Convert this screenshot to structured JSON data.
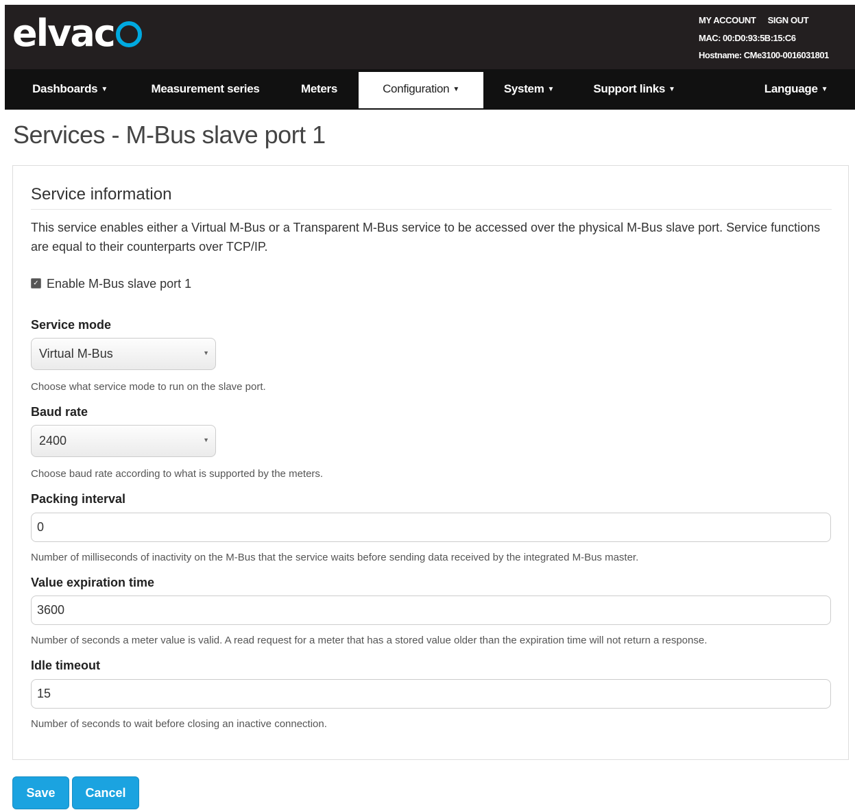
{
  "header": {
    "logo_text": "elvac",
    "account_links": [
      "MY ACCOUNT",
      "SIGN OUT"
    ],
    "mac": "MAC: 00:D0:93:5B:15:C6",
    "hostname": "Hostname: CMe3100-0016031801"
  },
  "nav": {
    "items": [
      {
        "label": "Dashboards",
        "dropdown": true
      },
      {
        "label": "Measurement series",
        "dropdown": false
      },
      {
        "label": "Meters",
        "dropdown": false
      },
      {
        "label": "Configuration",
        "dropdown": true,
        "active": true
      },
      {
        "label": "System",
        "dropdown": true
      },
      {
        "label": "Support links",
        "dropdown": true
      },
      {
        "label": "Language",
        "dropdown": true
      }
    ]
  },
  "page_title": "Services - M-Bus slave port 1",
  "section": {
    "title": "Service information",
    "description": "This service enables either a Virtual M-Bus or a Transparent M-Bus service to be accessed over the physical M-Bus slave port. Service functions are equal to their counterparts over TCP/IP.",
    "enable_label": "Enable M-Bus slave port 1",
    "enable_checked": true
  },
  "form": {
    "service_mode": {
      "label": "Service mode",
      "value": "Virtual M-Bus",
      "help": "Choose what service mode to run on the slave port."
    },
    "baud_rate": {
      "label": "Baud rate",
      "value": "2400",
      "help": "Choose baud rate according to what is supported by the meters."
    },
    "packing_interval": {
      "label": "Packing interval",
      "value": "0",
      "help": "Number of milliseconds of inactivity on the M-Bus that the service waits before sending data received by the integrated M-Bus master."
    },
    "value_expiration": {
      "label": "Value expiration time",
      "value": "3600",
      "help": "Number of seconds a meter value is valid. A read request for a meter that has a stored value older than the expiration time will not return a response."
    },
    "idle_timeout": {
      "label": "Idle timeout",
      "value": "15",
      "help": "Number of seconds to wait before closing an inactive connection."
    }
  },
  "buttons": {
    "save": "Save",
    "cancel": "Cancel"
  },
  "colors": {
    "header_bg": "#231f20",
    "nav_bg": "#111111",
    "accent": "#1ba3e0",
    "logo_o": "#00a9e0"
  }
}
